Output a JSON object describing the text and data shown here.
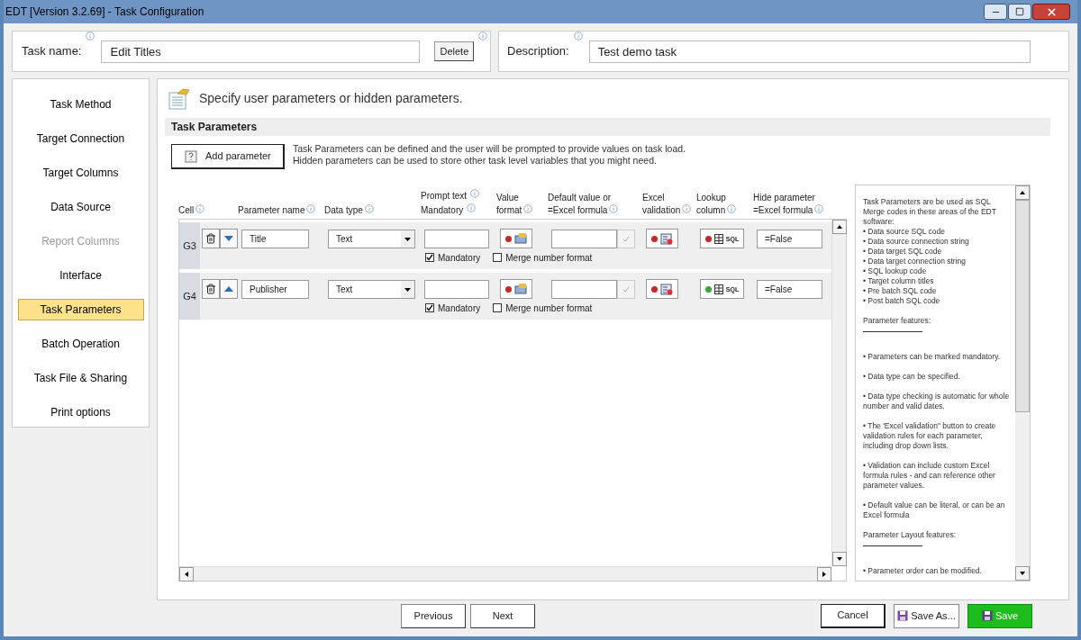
{
  "window": {
    "title": "EDT [Version 3.2.69] - Task Configuration"
  },
  "task_name": {
    "label": "Task name:",
    "value": "Edit Titles",
    "delete_button": "Delete"
  },
  "description": {
    "label": "Description:",
    "value": "Test demo task"
  },
  "sidebar": {
    "items": [
      {
        "label": "Task Method",
        "selected": false,
        "disabled": false
      },
      {
        "label": "Target Connection",
        "selected": false,
        "disabled": false
      },
      {
        "label": "Target Columns",
        "selected": false,
        "disabled": false
      },
      {
        "label": "Data Source",
        "selected": false,
        "disabled": false
      },
      {
        "label": "Report Columns",
        "selected": false,
        "disabled": true
      },
      {
        "label": "Interface",
        "selected": false,
        "disabled": false
      },
      {
        "label": "Task Parameters",
        "selected": true,
        "disabled": false
      },
      {
        "label": "Batch Operation",
        "selected": false,
        "disabled": false
      },
      {
        "label": "Task File & Sharing",
        "selected": false,
        "disabled": false
      },
      {
        "label": "Print options",
        "selected": false,
        "disabled": false
      }
    ]
  },
  "heading": "Specify user parameters or hidden parameters.",
  "section_title": "Task Parameters",
  "add_button": "Add parameter",
  "intro": [
    "Task Parameters can be defined and the user will be prompted to provide values on task load.",
    "Hidden parameters can be used to store other task level variables that you might need."
  ],
  "columns": [
    {
      "labels": [
        "Cell"
      ],
      "kind": "single"
    },
    {
      "labels": [
        "Parameter name"
      ],
      "kind": "single"
    },
    {
      "labels": [
        "Data type"
      ],
      "kind": "single"
    },
    {
      "labels": [
        "Prompt text",
        "Mandatory"
      ],
      "kind": "stacked"
    },
    {
      "labels": [
        "Value format"
      ],
      "kind": "single"
    },
    {
      "labels": [
        "Default value or =Excel formula"
      ],
      "kind": "single"
    },
    {
      "labels": [
        "Excel validation"
      ],
      "kind": "single"
    },
    {
      "labels": [
        "Lookup column"
      ],
      "kind": "single"
    },
    {
      "labels": [
        "Hide parameter =Excel formula"
      ],
      "kind": "single"
    }
  ],
  "rows": [
    {
      "cell": "G3",
      "move_up": false,
      "name": "Title",
      "data_type": "Text",
      "mandatory": true,
      "mandatory_label": "Mandatory",
      "merge_number_format": false,
      "merge_label": "Merge number format",
      "lookup_set": false,
      "lookup_label": "SQL",
      "hide": "=False"
    },
    {
      "cell": "G4",
      "move_up": true,
      "name": "Publisher",
      "data_type": "Text",
      "mandatory": true,
      "mandatory_label": "Mandatory",
      "merge_number_format": false,
      "merge_label": "Merge number format",
      "lookup_set": true,
      "lookup_label": "SQL",
      "hide": "=False"
    }
  ],
  "help": [
    {
      "kind": "text",
      "text": "Task Parameters are be used as SQL Merge codes in these areas of the EDT software:"
    },
    {
      "kind": "line",
      "text": "• Data source SQL code"
    },
    {
      "kind": "line",
      "text": "• Data source connection string"
    },
    {
      "kind": "line",
      "text": "• Data target SQL code"
    },
    {
      "kind": "line",
      "text": "• Data target connection string"
    },
    {
      "kind": "line",
      "text": "• SQL lookup code"
    },
    {
      "kind": "line",
      "text": "• Target column titles"
    },
    {
      "kind": "line",
      "text": "• Pre batch SQL code"
    },
    {
      "kind": "line",
      "text": "• Post batch SQL code"
    },
    {
      "kind": "text",
      "text": "Parameter features:"
    },
    {
      "kind": "rule"
    },
    {
      "kind": "text",
      "text": "• Parameters can be marked mandatory."
    },
    {
      "kind": "text",
      "text": "• Data type can be specified."
    },
    {
      "kind": "text",
      "text": "• Data type checking is automatic for whole number and valid dates."
    },
    {
      "kind": "text",
      "text": "• The 'Excel validation\" button to create validation rules for each parameter, including drop down lists."
    },
    {
      "kind": "text",
      "text": "• Validation can include custom Excel formula rules - and can reference other parameter values."
    },
    {
      "kind": "text",
      "text": "• Default value can be literal, or can be an Excel formula"
    },
    {
      "kind": "text",
      "text": "Parameter Layout features:"
    },
    {
      "kind": "rule"
    },
    {
      "kind": "text",
      "text": "• Parameter order can be modified."
    }
  ],
  "footer": {
    "previous": "Previous",
    "next": "Next",
    "cancel": "Cancel",
    "save_as": "Save As...",
    "save": "Save"
  }
}
